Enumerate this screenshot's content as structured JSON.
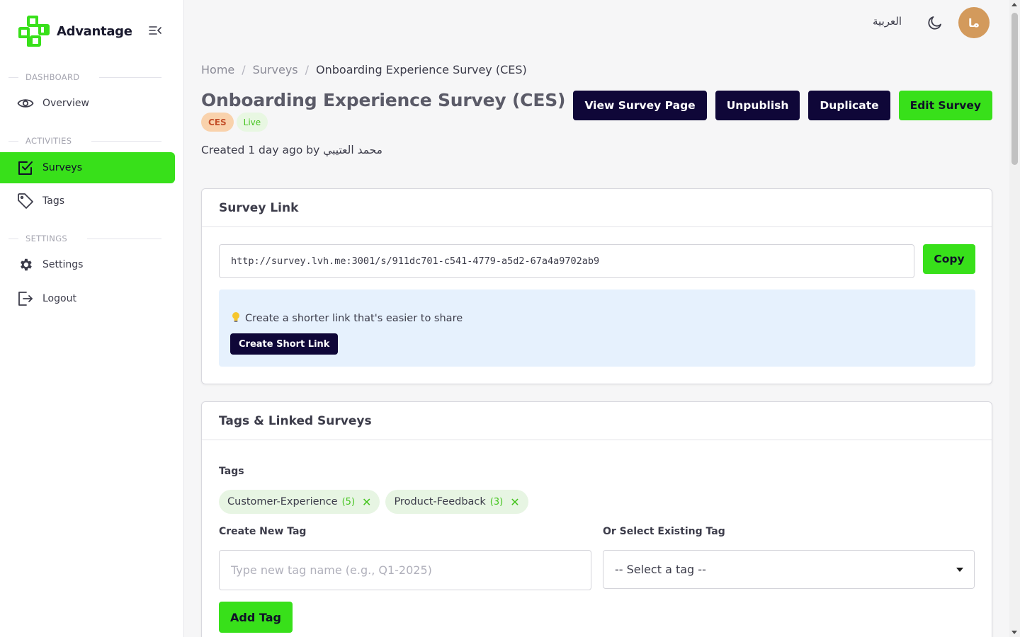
{
  "app": {
    "name": "Advantage"
  },
  "sidebar": {
    "sections": [
      {
        "label": "DASHBOARD"
      },
      {
        "label": "ACTIVITIES"
      },
      {
        "label": "SETTINGS"
      }
    ],
    "items": [
      {
        "label": "Overview",
        "icon": "eye-icon",
        "active": false
      },
      {
        "label": "Surveys",
        "icon": "checkbox-icon",
        "active": true
      },
      {
        "label": "Tags",
        "icon": "tag-icon",
        "active": false
      },
      {
        "label": "Settings",
        "icon": "gear-icon",
        "active": false
      },
      {
        "label": "Logout",
        "icon": "logout-icon",
        "active": false
      }
    ]
  },
  "topbar": {
    "language": "العربية",
    "theme_icon": "moon-icon",
    "avatar_initials": "ما"
  },
  "breadcrumb": [
    "Home",
    "Surveys",
    "Onboarding Experience Survey (CES)"
  ],
  "page": {
    "title": "Onboarding Experience Survey (CES)",
    "badges": [
      "CES",
      "Live"
    ],
    "created": "Created 1 day ago by محمد العتيبي"
  },
  "actions": {
    "view": "View Survey Page",
    "unpublish": "Unpublish",
    "duplicate": "Duplicate",
    "edit": "Edit Survey"
  },
  "survey_link": {
    "title": "Survey Link",
    "url": "http://survey.lvh.me:3001/s/911dc701-c541-4779-a5d2-67a4a9702ab9",
    "copy_label": "Copy",
    "tip": "Create a shorter link that's easier to share",
    "short_link_label": "Create Short Link"
  },
  "tags_card": {
    "title": "Tags & Linked Surveys",
    "tags_label": "Tags",
    "tags": [
      {
        "name": "Customer-Experience",
        "count": "(5)"
      },
      {
        "name": "Product-Feedback",
        "count": "(3)"
      }
    ],
    "create_label": "Create New Tag",
    "create_placeholder": "Type new tag name (e.g., Q1-2025)",
    "select_label": "Or Select Existing Tag",
    "select_value": "-- Select a tag --",
    "add_label": "Add Tag"
  },
  "colors": {
    "brand_green": "#38e01a",
    "brand_dark": "#0f0738",
    "avatar": "#d39a5c",
    "info_bg": "#e6f1fd"
  }
}
